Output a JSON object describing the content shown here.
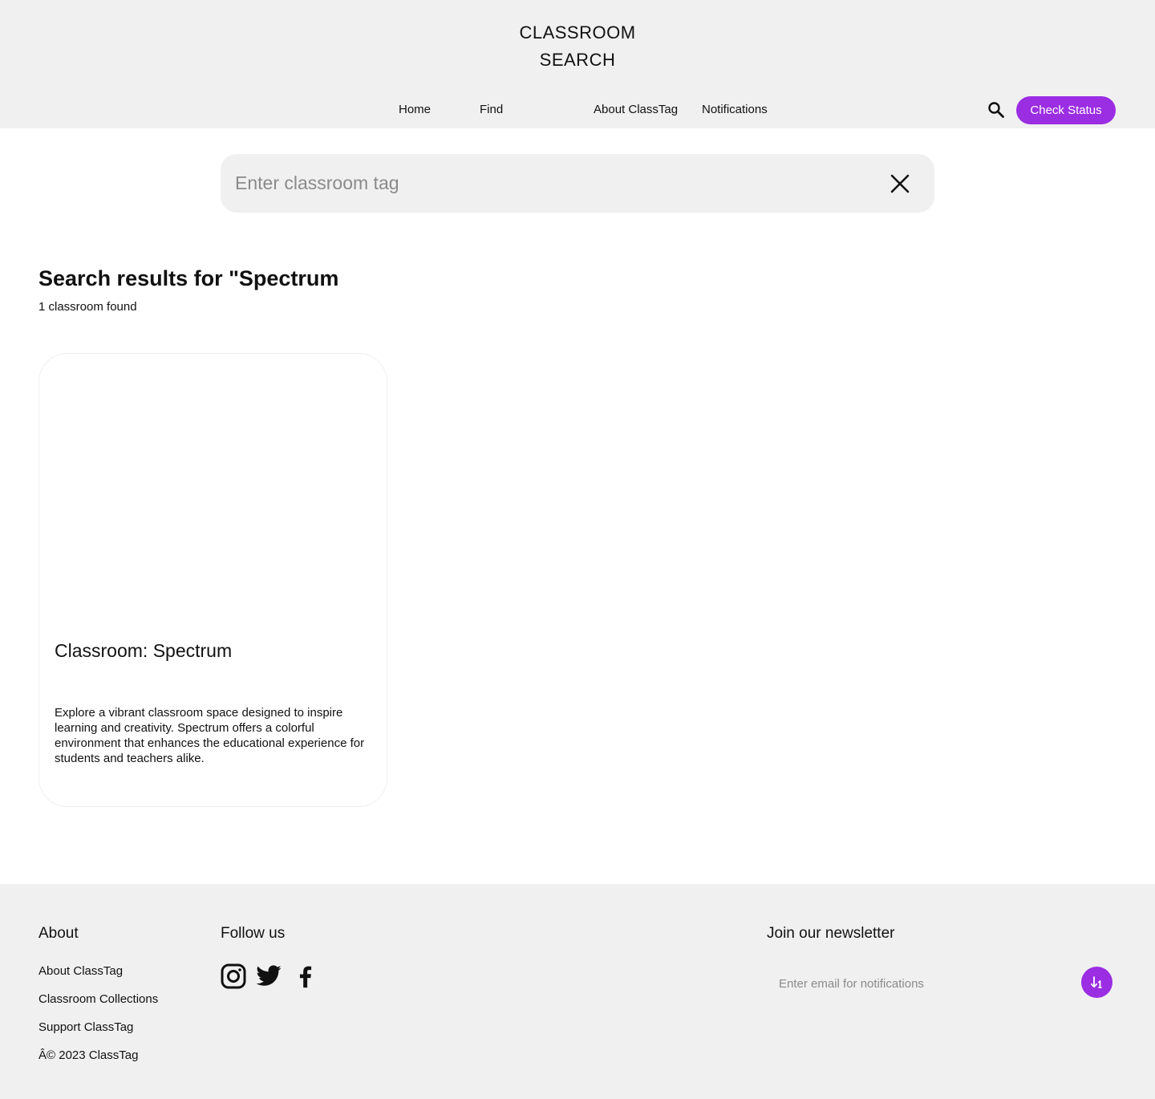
{
  "header": {
    "logo": "CLASSROOM\nSEARCH",
    "nav": {
      "home": "Home",
      "find": "Find",
      "about": "About ClassTag",
      "notifications": "Notifications"
    },
    "search_icon": "search-icon",
    "check_status": "Check Status",
    "accent_color": "#9b2de2"
  },
  "search": {
    "placeholder": "Enter classroom tag",
    "value": "",
    "clear_icon": "close-icon"
  },
  "results": {
    "title": "Search results for \"Spectrum",
    "count": "1 classroom found",
    "items": [
      {
        "title": "Classroom: Spectrum",
        "description": "Explore a vibrant classroom space designed to inspire learning and creativity. Spectrum offers a colorful environment that enhances the educational experience for students and teachers alike."
      }
    ]
  },
  "footer": {
    "about": {
      "heading": "About",
      "links": [
        "About ClassTag",
        "Classroom Collections",
        "Support ClassTag"
      ],
      "copyright": "Â© 2023 ClassTag"
    },
    "follow": {
      "heading": "Follow us",
      "icons": [
        "instagram-icon",
        "twitter-icon",
        "facebook-icon"
      ]
    },
    "newsletter": {
      "heading": "Join our newsletter",
      "placeholder": "Enter email for notifications",
      "button_icon": "sort-arrow-icon"
    }
  }
}
